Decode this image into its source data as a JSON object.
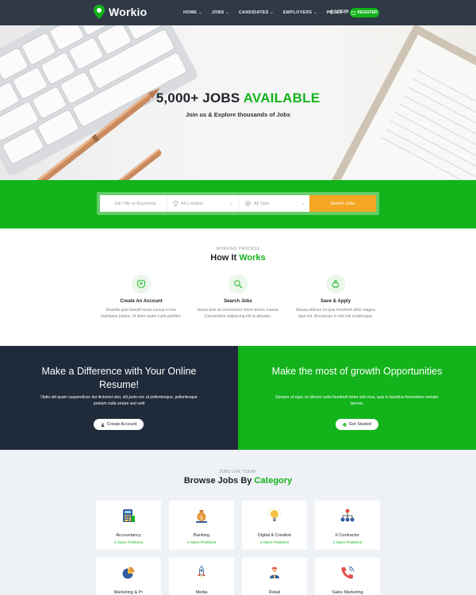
{
  "nav": {
    "brand": "Workio",
    "menu": [
      {
        "label": "HOME"
      },
      {
        "label": "JOBS"
      },
      {
        "label": "CANDIDATES"
      },
      {
        "label": "EMPLOYERS"
      },
      {
        "label": "PAGES"
      }
    ],
    "login": "LOGIN",
    "register": "REGISTER"
  },
  "hero": {
    "title_main": "5,000+ JOBS",
    "title_accent": "AVAILABLE",
    "subtitle": "Join us & Explore thousands of Jobs"
  },
  "search": {
    "keyword_placeholder": "Job Title or Keywords",
    "location_value": "All Location",
    "type_value": "All Type",
    "button": "Search Jobs"
  },
  "how_it_works": {
    "eyebrow": "WORKING PROCESS",
    "title_main": "How It",
    "title_accent": "Works",
    "steps": [
      {
        "title": "Create An Account",
        "desc": "Gravida quis blandit turpis cursus in hac habitasse platea. Ut diam quam nulla porttitor.",
        "icon": "shield-icon"
      },
      {
        "title": "Search Jobs",
        "desc": "Varius duis at consectetur lorem donec massa. Consectetur adipiscing elit ut aliquam.",
        "icon": "search-icon"
      },
      {
        "title": "Save & Apply",
        "desc": "Massa ultrices mi quis hendrerit dolor magna eget est. Accumsan in nisl nisi scelerisque.",
        "icon": "savings-icon"
      }
    ]
  },
  "cta": {
    "left": {
      "title": "Make a Difference with Your Online Resume!",
      "desc": "Optio elit quam suspendisse dui dictumst wisi, elit justo nec ut pellentesque, pellentesque pretium nulla ornare sed velit",
      "button": "Create Account"
    },
    "right": {
      "title": "Make the most of growth Opportunities",
      "desc": "Semper ut eget, et ultrices nulla hendrerit tortor wisi mus, quis in faucibus fermentum semper laoreet.",
      "button": "Get Started"
    }
  },
  "categories": {
    "eyebrow": "JOBS LIVE TODAY",
    "title_main": "Browse Jobs By",
    "title_accent": "Category",
    "items": [
      {
        "name": "Accountancy",
        "count": "2 Open Positions",
        "icon": "calculator-icon"
      },
      {
        "name": "Banking",
        "count": "0 Open Positions",
        "icon": "money-bag-icon"
      },
      {
        "name": "Digital & Creative",
        "count": "2 Open Positions",
        "icon": "lightbulb-icon"
      },
      {
        "name": "It Contractor",
        "count": "1 Open Positions",
        "icon": "hierarchy-icon"
      },
      {
        "name": "Marketing & Pr",
        "count": "",
        "icon": "pie-chart-icon"
      },
      {
        "name": "Media",
        "count": "",
        "icon": "rocket-icon"
      },
      {
        "name": "Retail",
        "count": "",
        "icon": "worker-icon"
      },
      {
        "name": "Sales Marketing",
        "count": "",
        "icon": "phone-icon"
      }
    ]
  },
  "colors": {
    "brand_green": "#13b31b",
    "nav_bg": "#2f3a46",
    "dark_cta": "#1f2a3a",
    "search_button": "#f5a623"
  }
}
